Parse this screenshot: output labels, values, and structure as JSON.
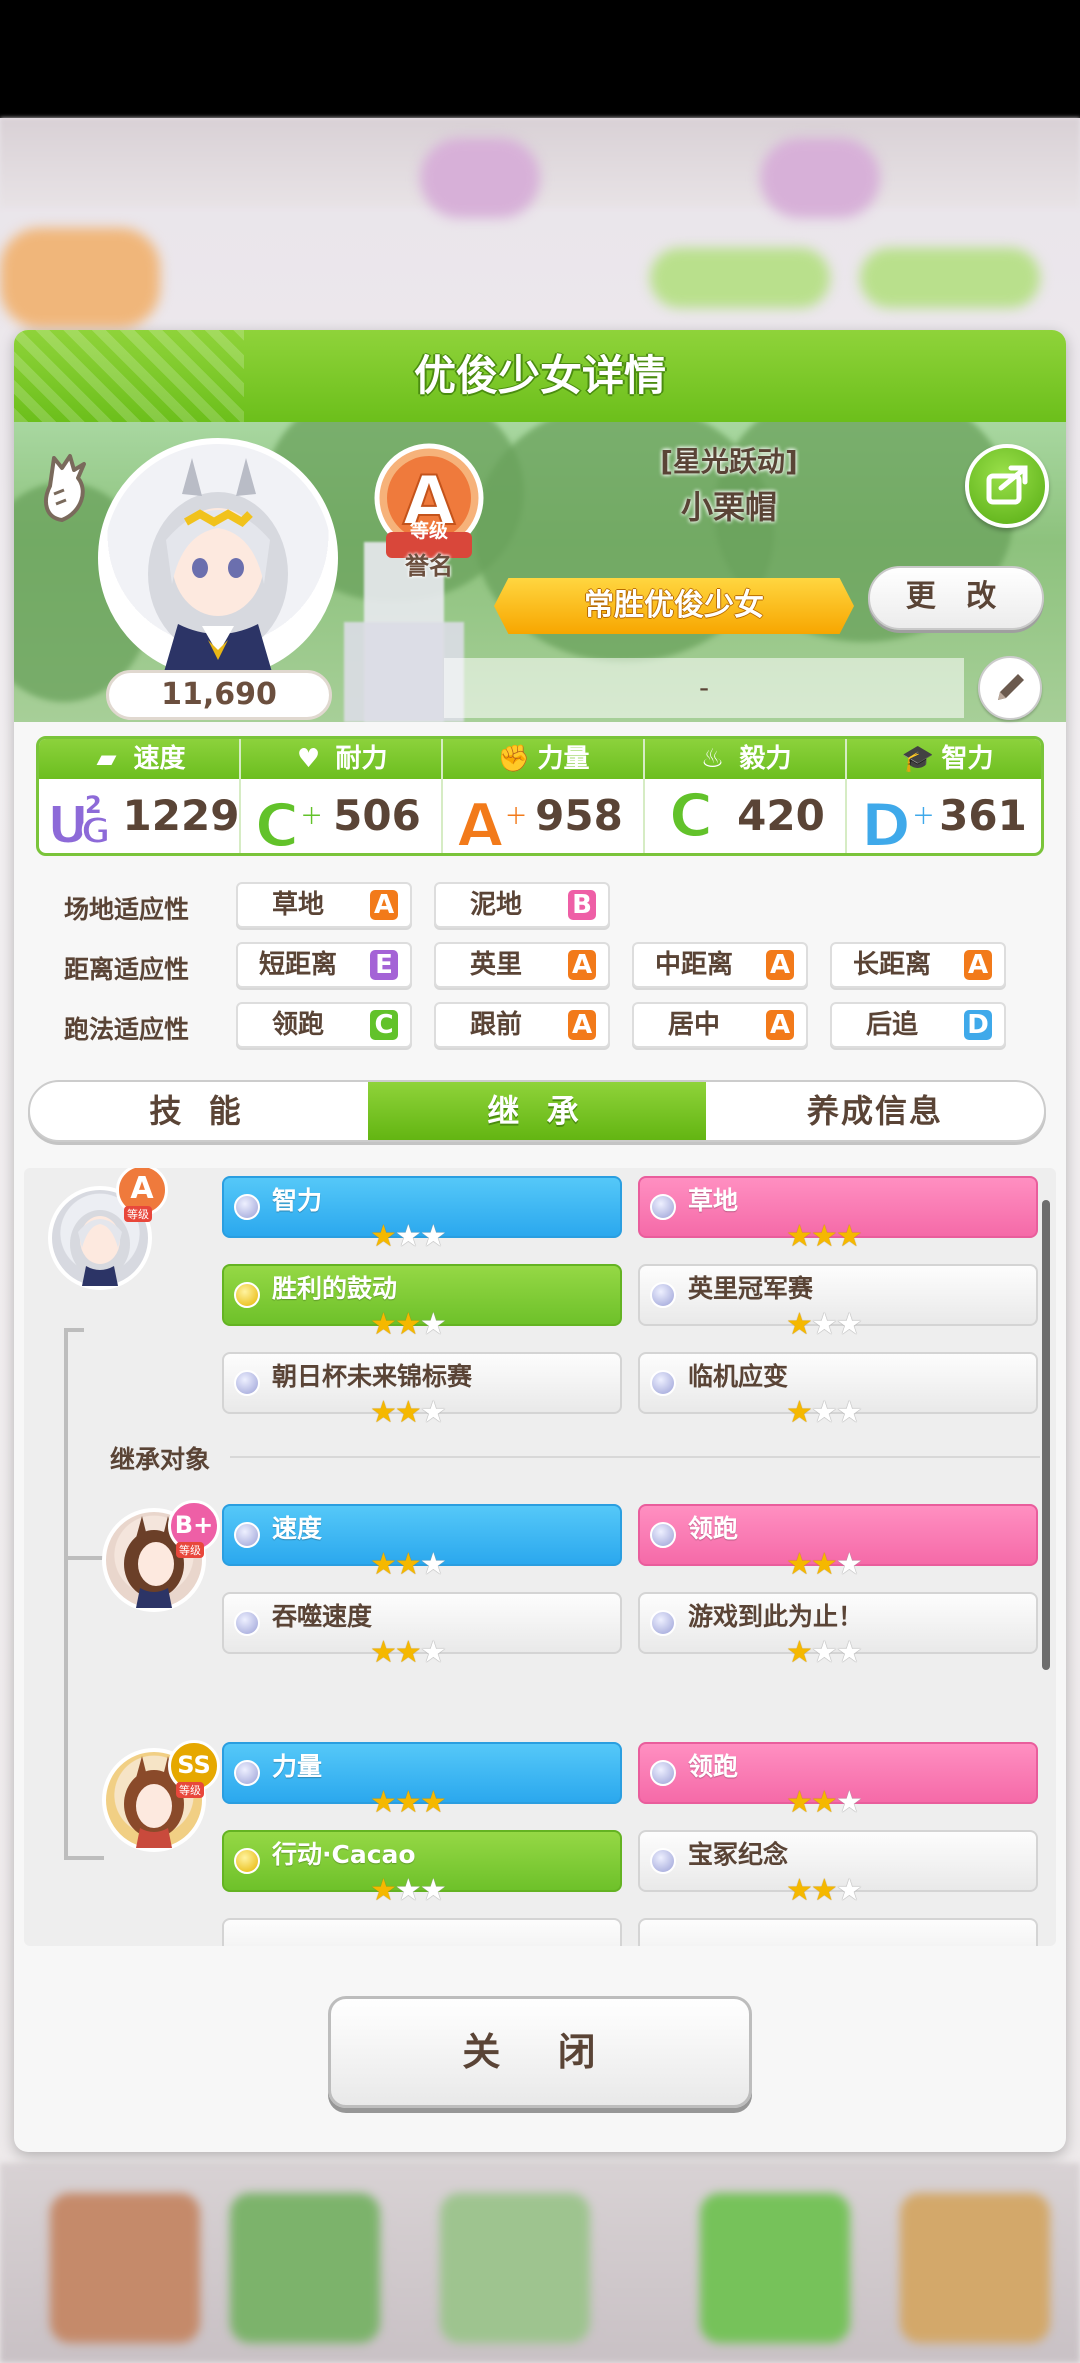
{
  "dialog": {
    "title": "优俊少女详情",
    "close_label": "关 闭"
  },
  "profile": {
    "score": "11,690",
    "grade": "A",
    "grade_label": "等级",
    "rank_label": "誉名",
    "outfit_title": "[星光跃动]",
    "name": "小栗帽",
    "nickname": "常胜优俊少女",
    "change_label": "更 改",
    "comment": "-"
  },
  "stats": [
    {
      "label": "速度",
      "icon": "shoe-icon",
      "grade": "UG",
      "grade_sub": "2",
      "value": "1229",
      "grade_color": "#8d6ad8"
    },
    {
      "label": "耐力",
      "icon": "heart-icon",
      "grade": "C",
      "grade_plus": "+",
      "value": "506",
      "grade_color": "#62c22a"
    },
    {
      "label": "力量",
      "icon": "muscle-icon",
      "grade": "A",
      "grade_plus": "+",
      "value": "958",
      "grade_color": "#f27a1a"
    },
    {
      "label": "毅力",
      "icon": "fire-icon",
      "grade": "C",
      "value": "420",
      "grade_color": "#62c22a"
    },
    {
      "label": "智力",
      "icon": "cap-icon",
      "grade": "D",
      "grade_plus": "+",
      "value": "361",
      "grade_color": "#3fa9ea"
    }
  ],
  "aptitudes": {
    "track": {
      "label": "场地适应性",
      "items": [
        {
          "name": "草地",
          "grade": "A"
        },
        {
          "name": "泥地",
          "grade": "B"
        }
      ]
    },
    "distance": {
      "label": "距离适应性",
      "items": [
        {
          "name": "短距离",
          "grade": "E"
        },
        {
          "name": "英里",
          "grade": "A"
        },
        {
          "name": "中距离",
          "grade": "A"
        },
        {
          "name": "长距离",
          "grade": "A"
        }
      ]
    },
    "style": {
      "label": "跑法适应性",
      "items": [
        {
          "name": "领跑",
          "grade": "C"
        },
        {
          "name": "跟前",
          "grade": "A"
        },
        {
          "name": "居中",
          "grade": "A"
        },
        {
          "name": "后追",
          "grade": "D"
        }
      ]
    }
  },
  "grade_colors": {
    "A": "#f27a1a",
    "B": "#ee5fa6",
    "C": "#62c22a",
    "D": "#3fa9ea",
    "E": "#a463d6"
  },
  "tabs": [
    "技 能",
    "继 承",
    "养成信息"
  ],
  "active_tab": "继 承",
  "inheritance": {
    "self": {
      "grade": "A",
      "grade_label": "等级",
      "factors": [
        {
          "name": "智力",
          "type": "blue",
          "stars": 1
        },
        {
          "name": "草地",
          "type": "pink",
          "stars": 3
        },
        {
          "name": "胜利的鼓动",
          "type": "green",
          "stars": 2
        },
        {
          "name": "英里冠军赛",
          "type": "white",
          "stars": 1
        },
        {
          "name": "朝日杯未来锦标赛",
          "type": "white",
          "stars": 2
        },
        {
          "name": "临机应变",
          "type": "white",
          "stars": 1
        }
      ]
    },
    "section_label": "继承对象",
    "parents": [
      {
        "grade": "B+",
        "grade_label": "等级",
        "factors": [
          {
            "name": "速度",
            "type": "blue",
            "stars": 2
          },
          {
            "name": "领跑",
            "type": "pink",
            "stars": 2
          },
          {
            "name": "吞噬速度",
            "type": "white",
            "stars": 2
          },
          {
            "name": "游戏到此为止！",
            "type": "white",
            "stars": 1
          }
        ]
      },
      {
        "grade": "SS",
        "grade_label": "等级",
        "factors": [
          {
            "name": "力量",
            "type": "blue",
            "stars": 3
          },
          {
            "name": "领跑",
            "type": "pink",
            "stars": 2
          },
          {
            "name": "行动·Cacao",
            "type": "green",
            "stars": 1
          },
          {
            "name": "宝冢纪念",
            "type": "white",
            "stars": 2
          }
        ]
      }
    ]
  }
}
